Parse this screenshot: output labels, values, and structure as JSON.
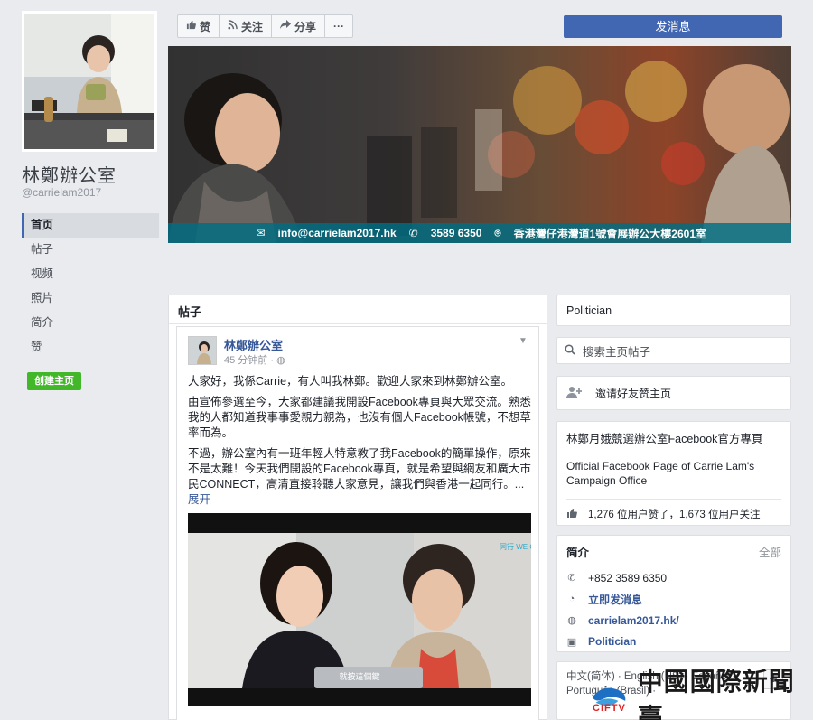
{
  "page": {
    "name": "林鄭辦公室",
    "handle": "@carrielam2017"
  },
  "nav": {
    "items": [
      {
        "label": "首页"
      },
      {
        "label": "帖子"
      },
      {
        "label": "视频"
      },
      {
        "label": "照片"
      },
      {
        "label": "简介"
      },
      {
        "label": "赞"
      }
    ],
    "create_page": "创建主页"
  },
  "toolbar": {
    "like": "赞",
    "follow": "关注",
    "share": "分享",
    "more": "···",
    "message": "发消息"
  },
  "cover": {
    "email": "info@carrielam2017.hk",
    "phone": "3589 6350",
    "address": "香港灣仔港灣道1號會展辦公大樓2601室"
  },
  "posts": {
    "header": "帖子",
    "author": "林鄭辦公室",
    "time": "45 分钟前",
    "p1": "大家好，我係Carrie，有人叫我林鄭。歡迎大家來到林鄭辦公室。",
    "p2": "由宣佈參選至今，大家都建議我開設Facebook專頁與大眾交流。熟悉我的人都知道我事事愛親力親為，也沒有個人Facebook帳號，不想草率而為。",
    "p3": "不過，辦公室內有一班年輕人特意教了我Facebook的簡單操作，原來不是太難！今天我們開設的Facebook專頁，就是希望與網友和廣大市民CONNECT，高清直接聆聽大家意見，讓我們與香港一起同行。...",
    "see_more": "展开",
    "video_caption": "就按這個鍵",
    "video_logo": "同行 WE CONNECT"
  },
  "sidebar": {
    "category": "Politician",
    "search_placeholder": "搜索主页帖子",
    "invite": "邀请好友赞主页",
    "about_title": "林鄭月娥競選辦公室Facebook官方專頁",
    "about_desc": "Official Facebook Page of Carrie Lam's Campaign Office",
    "likes_text": "1,276 位用户赞了，1,673 位用户关注",
    "intro_title": "简介",
    "intro_all": "全部",
    "intro_phone": "+852 3589 6350",
    "intro_message": "立即发消息",
    "intro_site": "carrielam2017.hk/",
    "intro_category": "Politician",
    "languages": "中文(简体) · English (US) · Español · Português (Brasil) ·"
  },
  "watermark": {
    "text": "中國國際新聞臺",
    "logo": "CIFTV"
  },
  "colors": {
    "brand_blue": "#4267b2",
    "link_blue": "#365899",
    "green": "#42b72a",
    "bg": "#e9ebee"
  }
}
